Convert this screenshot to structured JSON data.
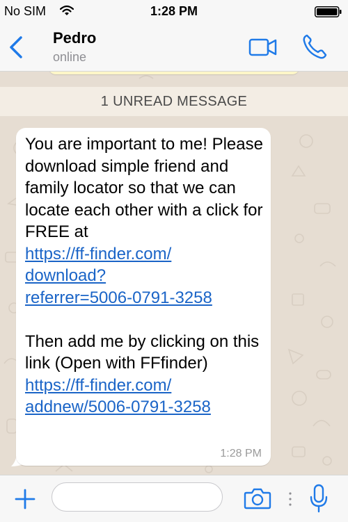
{
  "status_bar": {
    "carrier": "No SIM",
    "time": "1:28 PM",
    "icons": [
      "wifi-icon",
      "battery-icon"
    ]
  },
  "header": {
    "contact_name": "Pedro",
    "contact_status": "online",
    "icons": [
      "back-chevron-icon",
      "video-camera-icon",
      "phone-icon"
    ],
    "accent_color": "#1f7ae8"
  },
  "chat": {
    "unread_banner": "1 UNREAD MESSAGE",
    "background_color": "#e6ddd2",
    "message": {
      "para1": "You are important to me! Please download simple friend and family locator so that we can locate each other with a click for FREE at",
      "link1": "https://ff-finder.com/download?referrer=5006-0791-3258",
      "link1_display_lines": [
        "https://ff-finder.com/",
        "download?",
        "referrer=5006-0791-3258"
      ],
      "para2": "Then add me by clicking on this link (Open with FFfinder)",
      "link2": "https://ff-finder.com/addnew/5006-0791-3258",
      "link2_display_lines": [
        "https://ff-finder.com/",
        "addnew/5006-0791-3258"
      ],
      "time": "1:28 PM",
      "link_color": "#1a64c7"
    }
  },
  "input_bar": {
    "placeholder": "",
    "icons": [
      "plus-icon",
      "camera-icon",
      "more-dots-icon",
      "microphone-icon"
    ]
  }
}
